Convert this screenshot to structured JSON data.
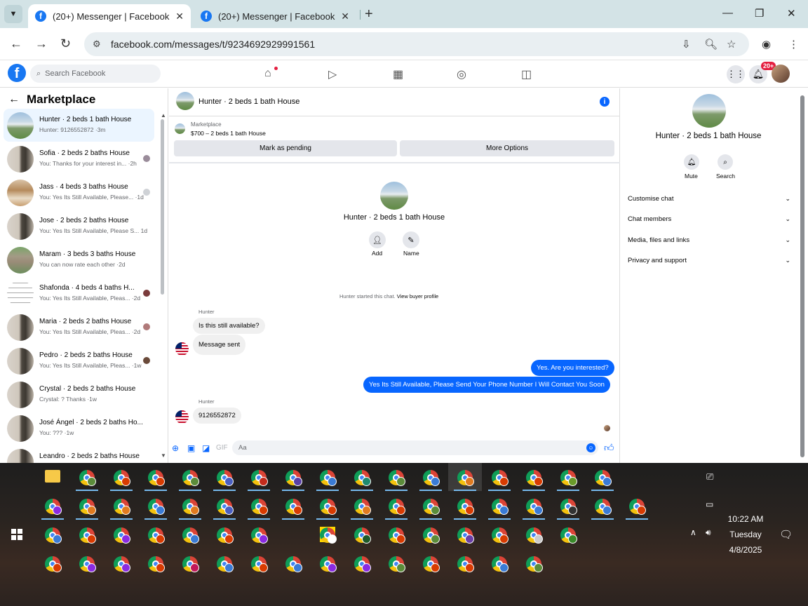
{
  "browser": {
    "tabs": [
      {
        "title": "(20+) Messenger | Facebook"
      },
      {
        "title": "(20+) Messenger | Facebook"
      }
    ],
    "url": "facebook.com/messages/t/9234692929991561"
  },
  "fb_header": {
    "search_placeholder": "Search Facebook",
    "notification_badge": "20+"
  },
  "left_panel": {
    "title": "Marketplace",
    "conversations": [
      {
        "title": "Hunter · 2 beds 1 bath House",
        "snippet": "Hunter: 9126552872 ·3m",
        "thumb": "house"
      },
      {
        "title": "Sofia · 2 beds 2 baths House",
        "snippet": "You: Thanks for your interest in... ·2h",
        "thumb": "door"
      },
      {
        "title": "Jass · 4 beds 3 baths House",
        "snippet": "You: Yes Its Still Available, Please... ·1d",
        "thumb": "house2"
      },
      {
        "title": "Jose · 2 beds 2 baths House",
        "snippet": "You: Yes Its Still Available, Please S... 1d",
        "thumb": "door"
      },
      {
        "title": "Maram · 3 beds 3 baths House",
        "snippet": "You can now rate each other ·2d",
        "thumb": "aerial"
      },
      {
        "title": "Shafonda · 4 beds 4 baths H...",
        "snippet": "You: Yes Its Still Available, Pleas... ·2d",
        "thumb": "plan"
      },
      {
        "title": "Maria · 2 beds 2 baths House",
        "snippet": "You: Yes Its Still Available, Pleas... ·2d",
        "thumb": "door"
      },
      {
        "title": "Pedro · 2 beds 2 baths House",
        "snippet": "You: Yes Its Still Available, Pleas... ·1w",
        "thumb": "door"
      },
      {
        "title": "Crystal · 2 beds 2 baths House",
        "snippet": "Crystal: ? Thanks ·1w",
        "thumb": "door"
      },
      {
        "title": "José Ángel · 2 beds 2 baths Ho...",
        "snippet": "You: ??? ·1w",
        "thumb": "door"
      },
      {
        "title": "Leandro · 2 beds 2 baths House",
        "snippet": "",
        "thumb": "door"
      }
    ]
  },
  "chat": {
    "header_title": "Hunter · 2 beds 1 bath House",
    "marketplace_label": "Marketplace",
    "listing": "$700 – 2 beds 1 bath House",
    "mark_pending": "Mark as pending",
    "more_options": "More Options",
    "center_title": "Hunter · 2 beds 1 bath House",
    "add_label": "Add",
    "name_label": "Name",
    "started_text": "Hunter started this chat.",
    "view_profile": "View buyer profile",
    "sender1": "Hunter",
    "msg1": "Is this still available?",
    "msg2": "Message sent",
    "out1": "Yes. Are you interested?",
    "out2": "Yes Its Still Available, Please Send Your Phone Number I Will Contact You Soon",
    "sender2": "Hunter",
    "msg3": "9126552872",
    "input_placeholder": "Aa"
  },
  "right_panel": {
    "title": "Hunter · 2 beds 1 bath House",
    "mute": "Mute",
    "search": "Search",
    "sections": [
      "Customise chat",
      "Chat members",
      "Media, files and links",
      "Privacy and support"
    ]
  },
  "taskbar": {
    "time": "10:22 AM",
    "day": "Tuesday",
    "date": "4/8/2025",
    "badge_colors": [
      [
        "#d83b01",
        "#5b8c3a",
        "#d83b01",
        "#d83b01",
        "#5b8c3a",
        "#4a5fc1",
        "#c42b1c",
        "#5a3fa6",
        "#3a7bd5",
        "#1e8a6e",
        "#5b8c3a",
        "#3a7bd5",
        "#e07a1f",
        "#d83b01",
        "#d83b01",
        "#6a9a2a",
        "#3a7bd5"
      ],
      [
        "#8a2be2",
        "#e07a1f",
        "#e07a1f",
        "#3a7bd5",
        "#e07a1f",
        "#4a5fc1",
        "#d83b01",
        "#d83b01",
        "#d83b01",
        "#e07a1f",
        "#d83b01",
        "#5b8c3a",
        "#d83b01",
        "#3a7bd5",
        "#3a7bd5",
        "#333333",
        "#3a7bd5",
        "#d83b01"
      ],
      [
        "#3a7bd5",
        "#d83b01",
        "#8a2be2",
        "#d83b01",
        "#3a7bd5",
        "#d83b01",
        "#8a2be2",
        "#ffd800",
        "#ffffff",
        "#1e5a2a",
        "#d83b01",
        "#5b8c3a",
        "#6a3fa6",
        "#d83b01",
        "#cccccc",
        "#3a8a2a"
      ],
      [
        "#d83b01",
        "#8a2be2",
        "#8a2be2",
        "#d83b01",
        "#c2185b",
        "#3a7bd5",
        "#d83b01",
        "#3a7bd5",
        "#8a2be2",
        "#8a2be2",
        "#5b8c3a",
        "#d83b01",
        "#d83b01",
        "#3a7bd5",
        "#5b8c3a"
      ]
    ]
  }
}
